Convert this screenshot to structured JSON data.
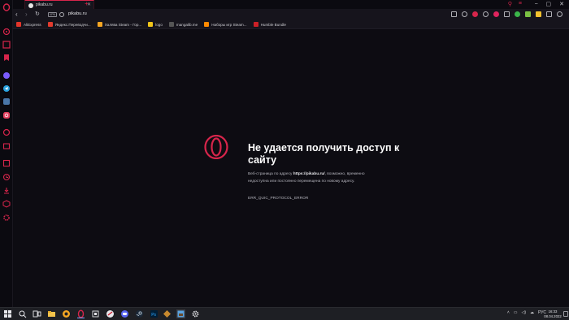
{
  "browser": {
    "tab": {
      "title": "pikabu.ru",
      "close": "✕"
    },
    "new_tab": "+",
    "window_controls": [
      "⎯",
      "▢",
      "✕"
    ],
    "address": {
      "back": "‹",
      "forward": "›",
      "reload": "↻",
      "vpn": "VPN",
      "url": "pikabu.ru"
    },
    "bookmarks": [
      {
        "label": "AliExpress",
        "color": "#e4352a"
      },
      {
        "label": "Яндекс.Переводчи...",
        "color": "#e23b2e"
      },
      {
        "label": "Халява Steam - Гор...",
        "color": "#f5a623"
      },
      {
        "label": "logo",
        "color": "#f0c419"
      },
      {
        "label": "mangalib.me",
        "color": "#444"
      },
      {
        "label": "Наборы игр Steam...",
        "color": "#ff8a00"
      },
      {
        "label": "Humble Bundle",
        "color": "#cc2027"
      }
    ],
    "accent": "#d7254b"
  },
  "error": {
    "title": "Не удается получить доступ к сайту",
    "desc_prefix": "Веб-страница по адресу ",
    "desc_url": "https://pikabu.ru/",
    "desc_suffix": ", возможно, временно недоступна или постоянно перемещена по новому адресу.",
    "code": "ERR_QUIC_PROTOCOL_ERROR"
  },
  "taskbar": {
    "lang": "РУС",
    "time": "16:33",
    "date": "08.04.2022"
  }
}
